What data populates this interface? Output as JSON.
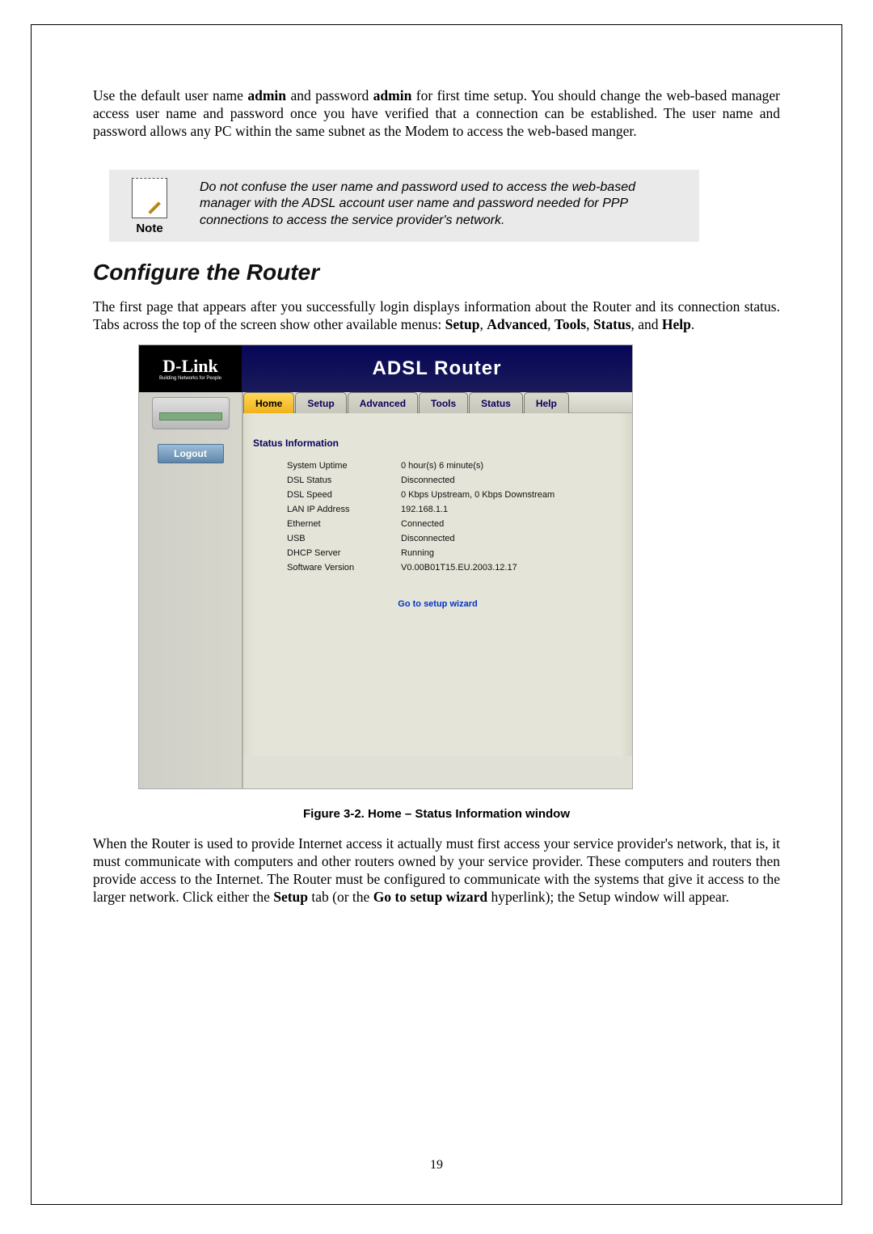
{
  "intro_para": {
    "pre": "Use the default user name ",
    "u": "admin",
    "mid": " and password ",
    "p": "admin",
    "post": " for first time setup. You should change the web-based manager access user name and password once you have verified that a connection can be established. The user name and password allows any PC within the same subnet as the Modem to access the web-based manger."
  },
  "note": {
    "caption": "Note",
    "text": "Do not confuse the user name and password used to access the web-based manager with the ADSL account user name and password needed for PPP connections to access the service provider's network."
  },
  "heading": "Configure the Router",
  "after_heading": {
    "pre": "The first page that appears after you successfully login displays information about the Router and its connection status. Tabs across the top of the screen show other available menus: ",
    "t1": "Setup",
    "t2": "Advanced",
    "t3": "Tools",
    "t4": "Status",
    "t5": "Help",
    "sep": ", ",
    "and": ", and ",
    "end": "."
  },
  "router": {
    "brand": "D-Link",
    "brand_tag": "Building Networks for People",
    "title": "ADSL Router",
    "logout": "Logout",
    "tabs": [
      "Home",
      "Setup",
      "Advanced",
      "Tools",
      "Status",
      "Help"
    ],
    "section": "Status Information",
    "rows": [
      {
        "label": "System Uptime",
        "value": "0 hour(s) 6 minute(s)"
      },
      {
        "label": "DSL Status",
        "value": "Disconnected"
      },
      {
        "label": "DSL Speed",
        "value": "0 Kbps Upstream, 0 Kbps Downstream"
      },
      {
        "label": "LAN IP Address",
        "value": "192.168.1.1"
      },
      {
        "label": "Ethernet",
        "value": "Connected"
      },
      {
        "label": "USB",
        "value": "Disconnected"
      },
      {
        "label": "DHCP Server",
        "value": "Running"
      },
      {
        "label": "Software Version",
        "value": "V0.00B01T15.EU.2003.12.17"
      }
    ],
    "wizard": "Go to setup wizard"
  },
  "figure_caption": "Figure 3-2. Home – Status Information window",
  "closing_para": {
    "pre": "When the Router is used to provide Internet access it actually must first access your service provider's network, that is, it must communicate with computers and other routers owned by your service provider. These computers and routers then provide access to the Internet. The Router must be configured to communicate with the systems that give it access to the larger network. Click either the ",
    "setup": "Setup",
    "mid": " tab (or the ",
    "wiz": "Go to setup wizard",
    "post": " hyperlink); the Setup window will appear."
  },
  "page_number": "19"
}
